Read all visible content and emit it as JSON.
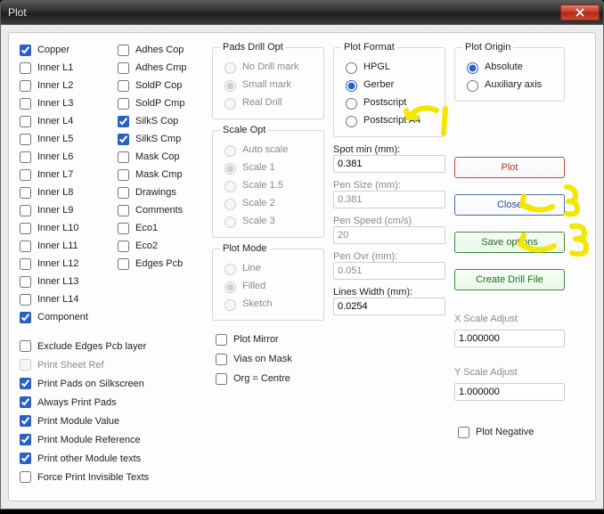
{
  "title": "Plot",
  "layers_col1": [
    {
      "label": "Copper",
      "checked": true
    },
    {
      "label": "Inner L1",
      "checked": false
    },
    {
      "label": "Inner L2",
      "checked": false
    },
    {
      "label": "Inner L3",
      "checked": false
    },
    {
      "label": "Inner L4",
      "checked": false
    },
    {
      "label": "Inner L5",
      "checked": false
    },
    {
      "label": "Inner L6",
      "checked": false
    },
    {
      "label": "Inner L7",
      "checked": false
    },
    {
      "label": "Inner L8",
      "checked": false
    },
    {
      "label": "Inner L9",
      "checked": false
    },
    {
      "label": "Inner L10",
      "checked": false
    },
    {
      "label": "Inner L11",
      "checked": false
    },
    {
      "label": "Inner L12",
      "checked": false
    },
    {
      "label": "Inner L13",
      "checked": false
    },
    {
      "label": "Inner L14",
      "checked": false
    },
    {
      "label": "Component",
      "checked": true
    }
  ],
  "layers_col2": [
    {
      "label": "Adhes Cop",
      "checked": false
    },
    {
      "label": "Adhes Cmp",
      "checked": false
    },
    {
      "label": "SoldP Cop",
      "checked": false
    },
    {
      "label": "SoldP Cmp",
      "checked": false
    },
    {
      "label": "SilkS Cop",
      "checked": true
    },
    {
      "label": "SilkS Cmp",
      "checked": true
    },
    {
      "label": "Mask Cop",
      "checked": false
    },
    {
      "label": "Mask Cmp",
      "checked": false
    },
    {
      "label": "Drawings",
      "checked": false
    },
    {
      "label": "Comments",
      "checked": false
    },
    {
      "label": "Eco1",
      "checked": false
    },
    {
      "label": "Eco2",
      "checked": false
    },
    {
      "label": "Edges Pcb",
      "checked": false
    }
  ],
  "long_opts": [
    {
      "label": "Exclude Edges Pcb layer",
      "checked": false
    },
    {
      "label": "Print Sheet Ref",
      "checked": false,
      "dim": true
    },
    {
      "label": "Print Pads on Silkscreen",
      "checked": true
    },
    {
      "label": "Always Print Pads",
      "checked": true
    },
    {
      "label": "Print Module Value",
      "checked": true
    },
    {
      "label": "Print Module Reference",
      "checked": true
    },
    {
      "label": "Print other Module texts",
      "checked": true
    },
    {
      "label": "Force Print Invisible Texts",
      "checked": false
    }
  ],
  "pads_drill": {
    "legend": "Pads Drill Opt",
    "opts": [
      "No Drill mark",
      "Small mark",
      "Real Drill"
    ],
    "selected": 1,
    "disabled": true
  },
  "scale_opt": {
    "legend": "Scale Opt",
    "opts": [
      "Auto scale",
      "Scale 1",
      "Scale 1.5",
      "Scale 2",
      "Scale 3"
    ],
    "selected": 1,
    "disabled": true
  },
  "plot_mode": {
    "legend": "Plot Mode",
    "opts": [
      "Line",
      "Filled",
      "Sketch"
    ],
    "selected": 1,
    "disabled": true
  },
  "col3_checks": [
    {
      "label": "Plot Mirror",
      "checked": false
    },
    {
      "label": "Vias on Mask",
      "checked": false
    },
    {
      "label": "Org = Centre",
      "checked": false
    }
  ],
  "plot_format": {
    "legend": "Plot Format",
    "opts": [
      "HPGL",
      "Gerber",
      "Postscript",
      "Postscript A4"
    ],
    "selected": 1
  },
  "fields": [
    {
      "label": "Spot min (mm):",
      "value": "0.381",
      "dim": false
    },
    {
      "label": "Pen Size (mm):",
      "value": "0.381",
      "dim": true
    },
    {
      "label": "Pen Speed (cm/s)",
      "value": "20",
      "dim": true
    },
    {
      "label": "Pen Ovr (mm):",
      "value": "0.051",
      "dim": true
    },
    {
      "label": "Lines Width (mm):",
      "value": "0.0254",
      "dim": false
    }
  ],
  "plot_origin": {
    "legend": "Plot Origin",
    "opts": [
      "Absolute",
      "Auxiliary axis"
    ],
    "selected": 0
  },
  "buttons": {
    "plot": "Plot",
    "close": "Close",
    "save": "Save options",
    "drill": "Create Drill File"
  },
  "xscale": {
    "label": "X Scale Adjust",
    "value": "1.000000"
  },
  "yscale": {
    "label": "Y Scale Adjust",
    "value": "1.000000"
  },
  "plot_negative": {
    "label": "Plot Negative",
    "checked": false
  },
  "annotations": {
    "yellow": "#f3e600"
  }
}
